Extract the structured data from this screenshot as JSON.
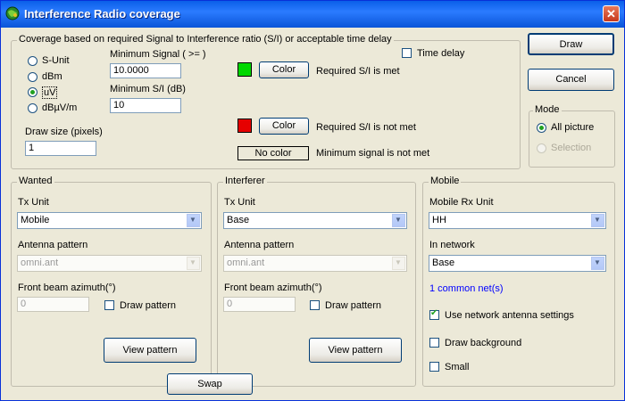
{
  "window": {
    "title": "Interference Radio coverage"
  },
  "coverage": {
    "title": "Coverage based on  required Signal to Interference ratio (S/I) or acceptable time delay",
    "units": [
      {
        "label": "S-Unit",
        "selected": false
      },
      {
        "label": "dBm",
        "selected": false
      },
      {
        "label": "uV",
        "selected": true
      },
      {
        "label": "dBµV/m",
        "selected": false
      }
    ],
    "min_signal_label": "Minimum Signal ( >= )",
    "min_signal_value": "10.0000",
    "min_si_label": "Minimum S/I (dB)",
    "min_si_value": "10",
    "draw_size_label": "Draw size (pixels)",
    "draw_size_value": "1",
    "time_delay_label": "Time delay",
    "color_button_label": "Color",
    "met_label": "Required S/I is met",
    "met_color": "#00d800",
    "not_met_label": "Required S/I is not met",
    "not_met_color": "#e60000",
    "no_color_label": "No color",
    "min_not_met_label": "Minimum signal is not met"
  },
  "buttons": {
    "draw": "Draw",
    "cancel": "Cancel",
    "swap": "Swap"
  },
  "mode": {
    "title": "Mode",
    "all_picture": "All picture",
    "selection": "Selection"
  },
  "wanted": {
    "title": "Wanted",
    "tx_unit_label": "Tx Unit",
    "tx_unit_value": "Mobile",
    "antenna_label": "Antenna pattern",
    "antenna_value": "omni.ant",
    "azimuth_label": "Front beam azimuth(°)",
    "azimuth_value": "0",
    "draw_pattern_label": "Draw pattern",
    "view_pattern_label": "View pattern"
  },
  "interferer": {
    "title": "Interferer",
    "tx_unit_label": "Tx Unit",
    "tx_unit_value": "Base",
    "antenna_label": "Antenna pattern",
    "antenna_value": "omni.ant",
    "azimuth_label": "Front beam azimuth(°)",
    "azimuth_value": "0",
    "draw_pattern_label": "Draw pattern",
    "view_pattern_label": "View pattern"
  },
  "mobile": {
    "title": "Mobile",
    "rx_unit_label": "Mobile Rx Unit",
    "rx_unit_value": "HH",
    "network_label": "In network",
    "network_value": "Base",
    "common_net": "1 common net(s)",
    "common_net_color": "#0000ff",
    "use_antenna_label": "Use network antenna settings",
    "draw_background_label": "Draw background",
    "small_label": "Small"
  }
}
